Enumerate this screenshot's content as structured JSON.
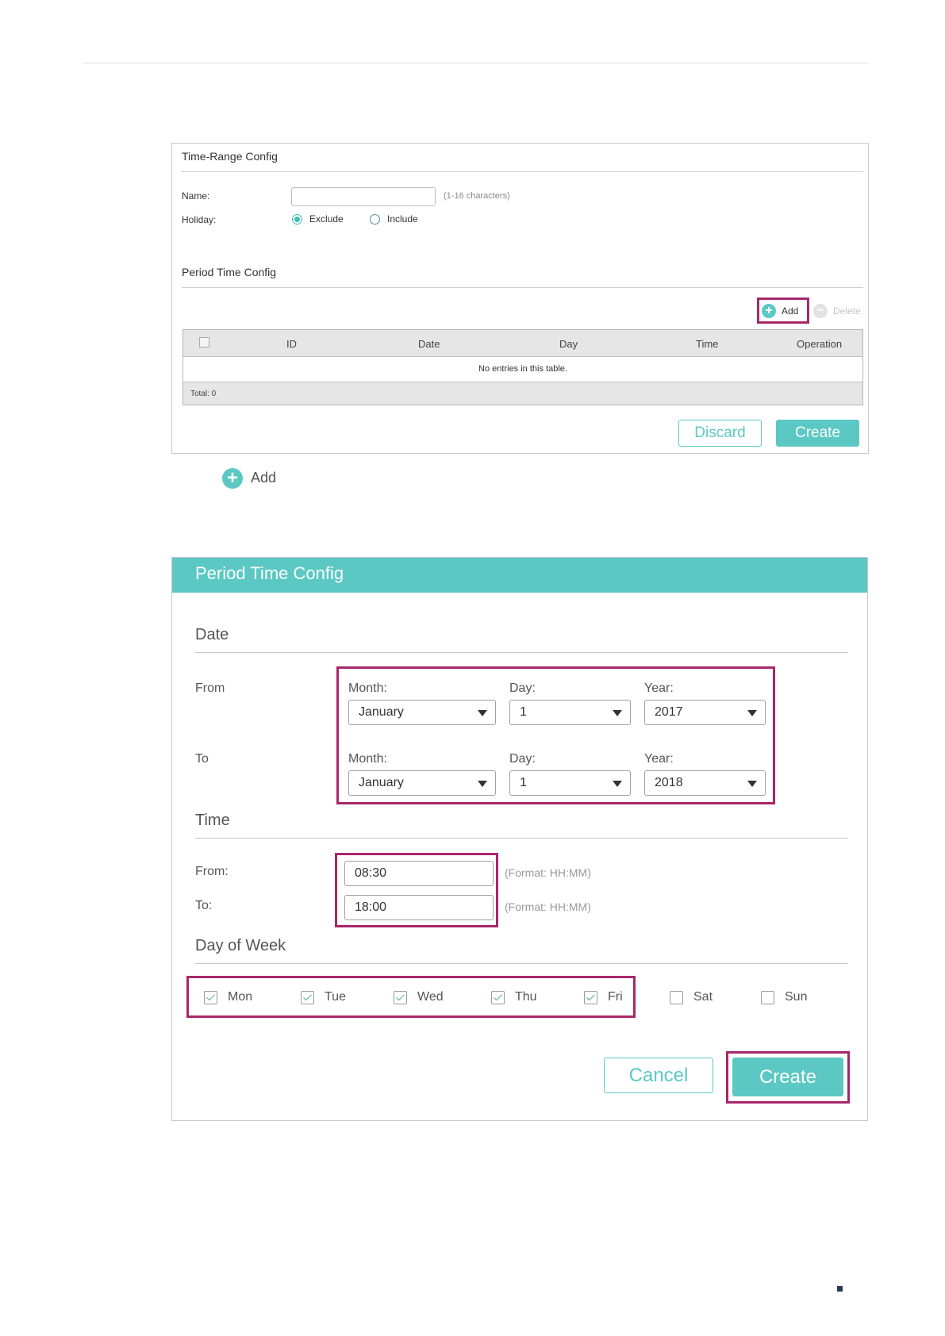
{
  "panel1": {
    "title": "Time-Range Config",
    "name_label": "Name:",
    "name_value": "",
    "name_hint": "(1-16 characters)",
    "holiday_label": "Holiday:",
    "holiday_options": [
      {
        "label": "Exclude",
        "selected": true
      },
      {
        "label": "Include",
        "selected": false
      }
    ],
    "period_title": "Period Time Config",
    "add_label": "Add",
    "delete_label": "Delete",
    "table": {
      "columns": [
        "ID",
        "Date",
        "Day",
        "Time",
        "Operation"
      ],
      "empty_message": "No entries in this table.",
      "total": "Total: 0"
    },
    "discard_label": "Discard",
    "create_label": "Create"
  },
  "middle_add_label": "Add",
  "panel2": {
    "title": "Period Time Config",
    "date_section": "Date",
    "from_label": "From",
    "to_label": "To",
    "from": {
      "month_label": "Month:",
      "month": "January",
      "day_label": "Day:",
      "day": "1",
      "year_label": "Year:",
      "year": "2017"
    },
    "to": {
      "month_label": "Month:",
      "month": "January",
      "day_label": "Day:",
      "day": "1",
      "year_label": "Year:",
      "year": "2018"
    },
    "time_section": "Time",
    "time_from_label": "From:",
    "time_from": "08:30",
    "time_to_label": "To:",
    "time_to": "18:00",
    "format_hint": "(Format: HH:MM)",
    "dow_section": "Day of Week",
    "days": [
      {
        "label": "Mon",
        "checked": true
      },
      {
        "label": "Tue",
        "checked": true
      },
      {
        "label": "Wed",
        "checked": true
      },
      {
        "label": "Thu",
        "checked": true
      },
      {
        "label": "Fri",
        "checked": true
      },
      {
        "label": "Sat",
        "checked": false
      },
      {
        "label": "Sun",
        "checked": false
      }
    ],
    "cancel_label": "Cancel",
    "create_label": "Create"
  },
  "colors": {
    "accent": "#5bc8c4",
    "highlight": "#a8276b"
  }
}
